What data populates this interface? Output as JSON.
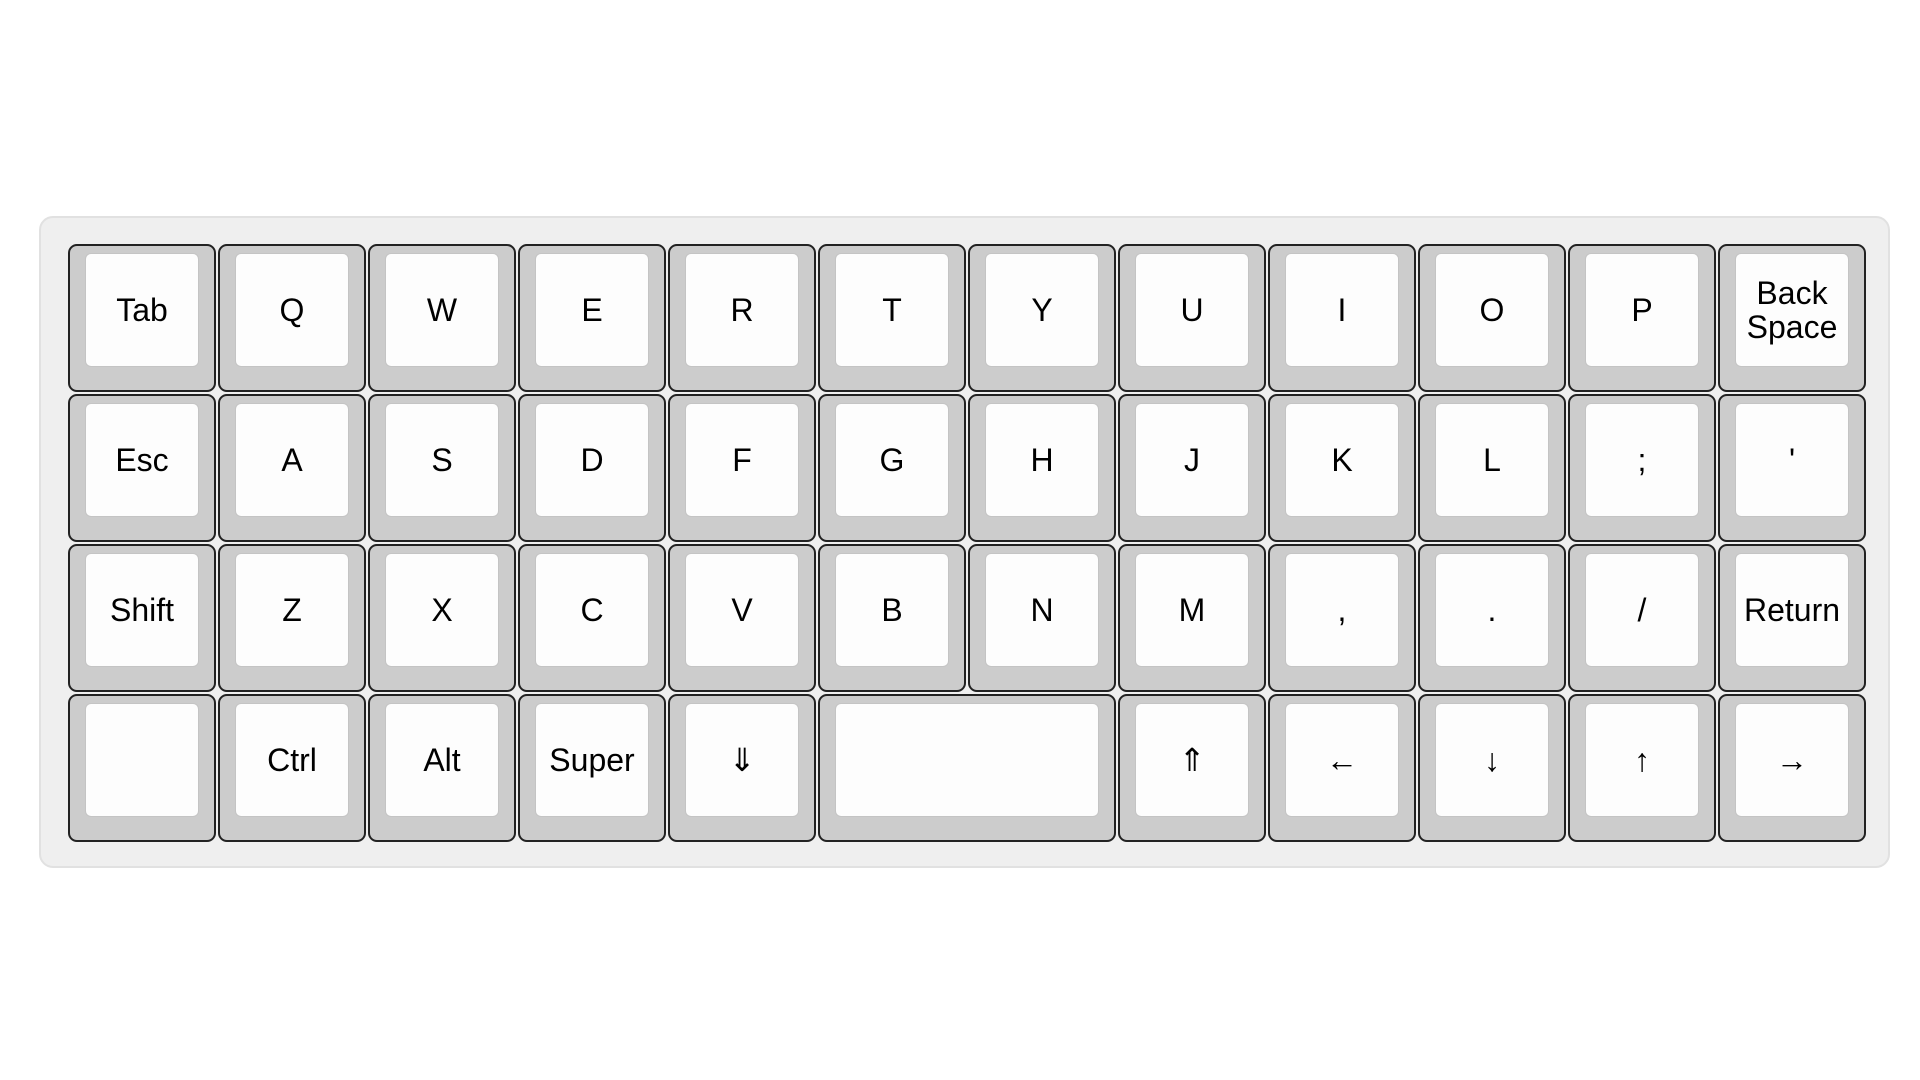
{
  "keyboard": {
    "rows": [
      {
        "keys": [
          {
            "name": "key-tab",
            "label": "Tab",
            "span": 1
          },
          {
            "name": "key-q",
            "label": "Q",
            "span": 1
          },
          {
            "name": "key-w",
            "label": "W",
            "span": 1
          },
          {
            "name": "key-e",
            "label": "E",
            "span": 1
          },
          {
            "name": "key-r",
            "label": "R",
            "span": 1
          },
          {
            "name": "key-t",
            "label": "T",
            "span": 1
          },
          {
            "name": "key-y",
            "label": "Y",
            "span": 1
          },
          {
            "name": "key-u",
            "label": "U",
            "span": 1
          },
          {
            "name": "key-i",
            "label": "I",
            "span": 1
          },
          {
            "name": "key-o",
            "label": "O",
            "span": 1
          },
          {
            "name": "key-p",
            "label": "P",
            "span": 1
          },
          {
            "name": "key-backspace",
            "label": "Back\nSpace",
            "span": 1
          }
        ]
      },
      {
        "keys": [
          {
            "name": "key-esc",
            "label": "Esc",
            "span": 1
          },
          {
            "name": "key-a",
            "label": "A",
            "span": 1
          },
          {
            "name": "key-s",
            "label": "S",
            "span": 1
          },
          {
            "name": "key-d",
            "label": "D",
            "span": 1
          },
          {
            "name": "key-f",
            "label": "F",
            "span": 1
          },
          {
            "name": "key-g",
            "label": "G",
            "span": 1
          },
          {
            "name": "key-h",
            "label": "H",
            "span": 1
          },
          {
            "name": "key-j",
            "label": "J",
            "span": 1
          },
          {
            "name": "key-k",
            "label": "K",
            "span": 1
          },
          {
            "name": "key-l",
            "label": "L",
            "span": 1
          },
          {
            "name": "key-semicolon",
            "label": ";",
            "span": 1
          },
          {
            "name": "key-quote",
            "label": "'",
            "span": 1
          }
        ]
      },
      {
        "keys": [
          {
            "name": "key-shift",
            "label": "Shift",
            "span": 1
          },
          {
            "name": "key-z",
            "label": "Z",
            "span": 1
          },
          {
            "name": "key-x",
            "label": "X",
            "span": 1
          },
          {
            "name": "key-c",
            "label": "C",
            "span": 1
          },
          {
            "name": "key-v",
            "label": "V",
            "span": 1
          },
          {
            "name": "key-b",
            "label": "B",
            "span": 1
          },
          {
            "name": "key-n",
            "label": "N",
            "span": 1
          },
          {
            "name": "key-m",
            "label": "M",
            "span": 1
          },
          {
            "name": "key-comma",
            "label": ",",
            "span": 1
          },
          {
            "name": "key-period",
            "label": ".",
            "span": 1
          },
          {
            "name": "key-slash",
            "label": "/",
            "span": 1
          },
          {
            "name": "key-return",
            "label": "Return",
            "span": 1
          }
        ]
      },
      {
        "keys": [
          {
            "name": "key-blank",
            "label": "",
            "span": 1
          },
          {
            "name": "key-ctrl",
            "label": "Ctrl",
            "span": 1
          },
          {
            "name": "key-alt",
            "label": "Alt",
            "span": 1
          },
          {
            "name": "key-super",
            "label": "Super",
            "span": 1
          },
          {
            "name": "key-lower",
            "label": "⇓",
            "span": 1
          },
          {
            "name": "key-space",
            "label": "",
            "span": 2
          },
          {
            "name": "key-raise",
            "label": "⇑",
            "span": 1
          },
          {
            "name": "key-left",
            "label": "←",
            "span": 1
          },
          {
            "name": "key-down",
            "label": "↓",
            "span": 1
          },
          {
            "name": "key-up",
            "label": "↑",
            "span": 1
          },
          {
            "name": "key-right",
            "label": "→",
            "span": 1
          }
        ]
      }
    ]
  }
}
